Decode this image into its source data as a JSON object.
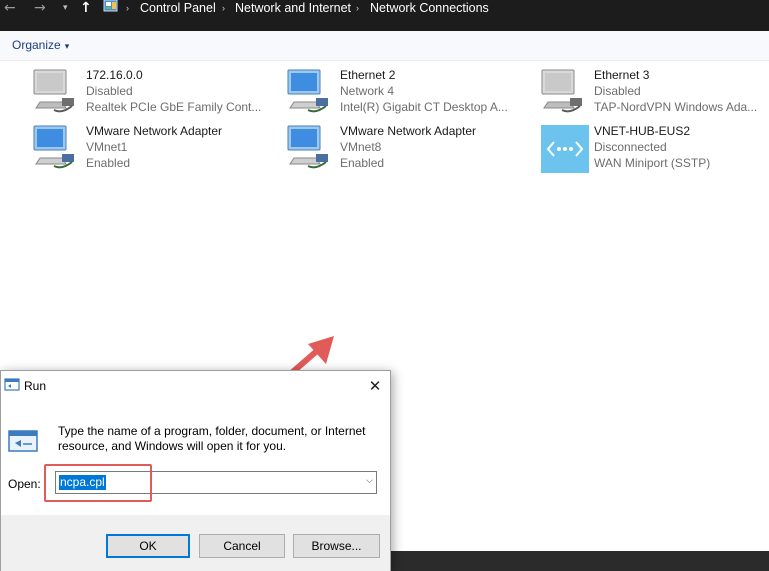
{
  "address_bar": {
    "back_icon": "back-arrow-icon",
    "forward_icon": "forward-arrow-icon",
    "up_icon": "up-arrow-icon",
    "breadcrumbs": [
      "Control Panel",
      "Network and Internet",
      "Network Connections"
    ]
  },
  "command_bar": {
    "organize_label": "Organize"
  },
  "connections": [
    {
      "name": "172.16.0.0",
      "status": "Disabled",
      "device": "Realtek PCIe GbE Family Cont...",
      "icon": "network-adapter-icon"
    },
    {
      "name": "Ethernet 2",
      "status": "Network 4",
      "device": "Intel(R) Gigabit CT Desktop A...",
      "icon": "network-adapter-icon"
    },
    {
      "name": "Ethernet 3",
      "status": "Disabled",
      "device": "TAP-NordVPN Windows Ada...",
      "icon": "network-adapter-icon"
    },
    {
      "name": "VMware Network Adapter",
      "status": "VMnet1",
      "device": "Enabled",
      "icon": "network-adapter-icon"
    },
    {
      "name": "VMware Network Adapter",
      "status": "VMnet8",
      "device": "Enabled",
      "icon": "network-adapter-icon"
    },
    {
      "name": "VNET-HUB-EUS2",
      "status": "Disconnected",
      "device": "WAN Miniport (SSTP)",
      "icon": "vpn-connection-icon"
    }
  ],
  "run_dialog": {
    "title": "Run",
    "description": "Type the name of a program, folder, document, or Internet resource, and Windows will open it for you.",
    "open_label": "Open:",
    "input_value": "ncpa.cpl",
    "ok_label": "OK",
    "cancel_label": "Cancel",
    "browse_label": "Browse..."
  },
  "colors": {
    "annotation": "#e15b59",
    "selection": "#0078d7",
    "address_bar_bg": "#1c1c1c"
  }
}
